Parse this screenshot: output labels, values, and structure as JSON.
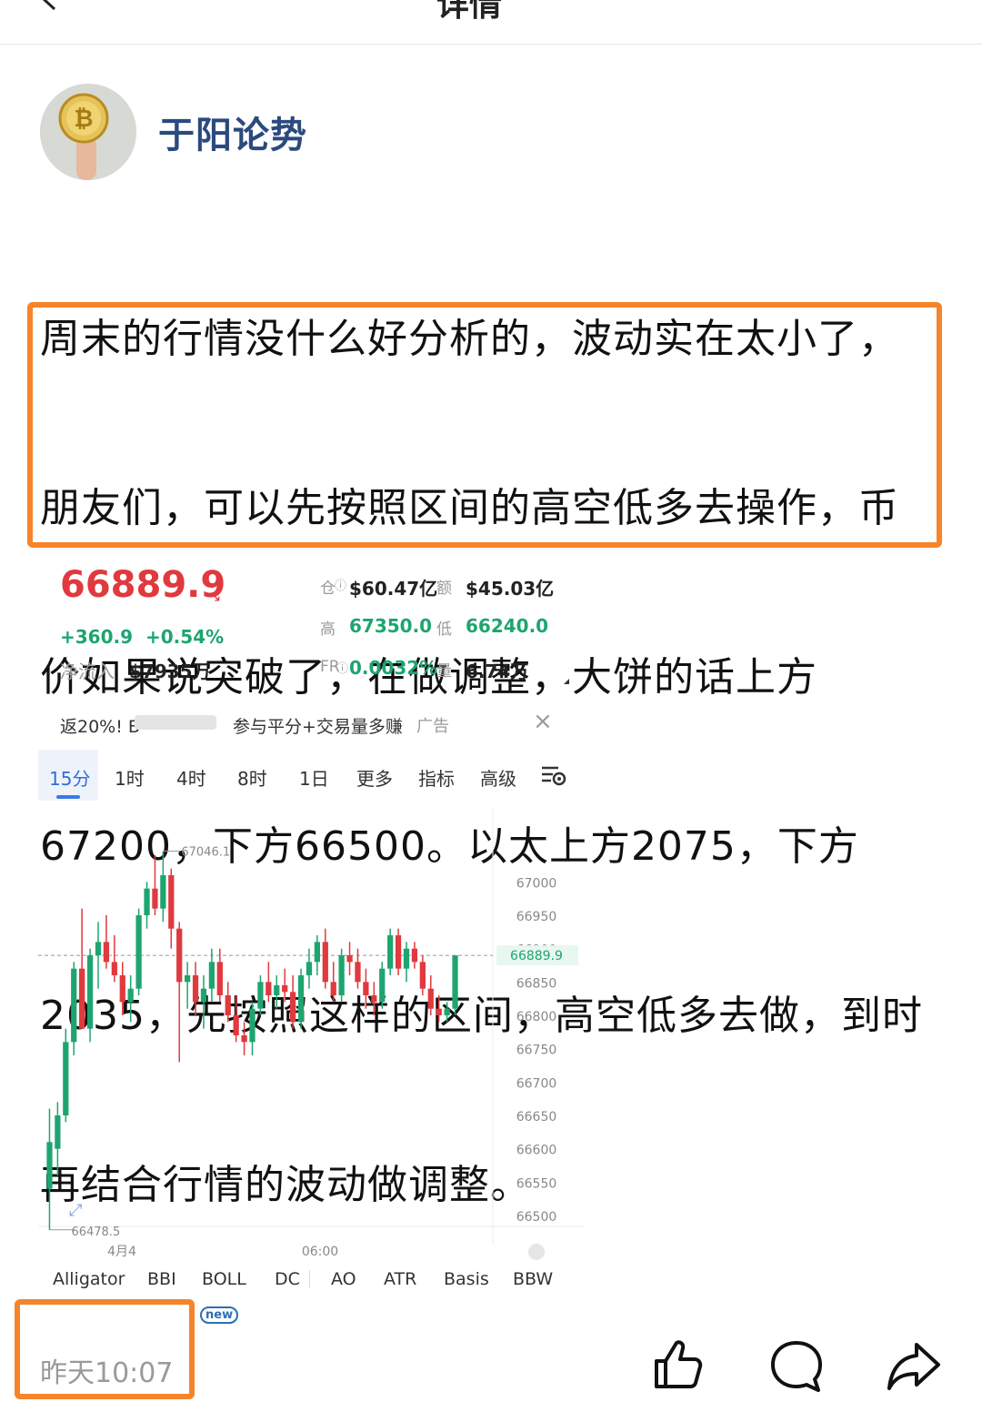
{
  "topbar": {
    "title": "详情"
  },
  "author": {
    "name": "于阳论势"
  },
  "post": {
    "lines": [
      "周末的行情没什么好分析的，波动实在太小了，",
      "朋友们，可以先按照区间的高空低多去操作，币",
      "价如果说突破了，在做调整，大饼的话上方",
      "67200，下方66500。以太上方2075，下方",
      "2035，先按照这样的区间，高空低多去做，到时",
      "再结合行情的波动做调整。"
    ]
  },
  "ticker": {
    "price": "66889.9",
    "change": "+360.9",
    "change_pct": "+0.54%",
    "netflow_label": "净流入",
    "netflow": "$7935万",
    "oi_label": "仓",
    "oi": "$60.47亿",
    "turnover_label": "额",
    "turnover": "$45.03亿",
    "high_label": "高",
    "high": "67350.0",
    "low_label": "低",
    "low": "66240.0",
    "fr_label": "FR",
    "fr": "0.0032%",
    "volume_label": "量",
    "volume": "6.74万"
  },
  "ad": {
    "prefix": "返20%! B",
    "text": "参与平分+交易量多赚",
    "tag": "广告",
    "close": "×"
  },
  "tabs": [
    "15分",
    "1时",
    "4时",
    "8时",
    "1日",
    "更多",
    "指标",
    "高级"
  ],
  "active_tab": 0,
  "indicators": [
    "Alligator",
    "BBI",
    "BOLL",
    "DC",
    "AO",
    "ATR",
    "Basis",
    "BBW"
  ],
  "new_badge": "new",
  "post_time": "昨天10:07",
  "colors": {
    "up": "#1ea56f",
    "down": "#e0393e",
    "accent": "#f5842a",
    "author": "#2b4a7e"
  },
  "chart_data": {
    "type": "candlestick",
    "y_ticks": [
      67000,
      66950,
      66900,
      66850,
      66800,
      66750,
      66700,
      66650,
      66600,
      66550,
      66500
    ],
    "ylim": [
      66470,
      67070
    ],
    "x_labels": [
      "4月4",
      "06:00"
    ],
    "current_price": "66889.9",
    "high_annotation": "67046.1",
    "low_annotation": "66478.5",
    "candles": [
      {
        "o": 66540,
        "h": 66660,
        "l": 66478.5,
        "c": 66610
      },
      {
        "o": 66600,
        "h": 66670,
        "l": 66560,
        "c": 66650
      },
      {
        "o": 66650,
        "h": 66780,
        "l": 66640,
        "c": 66760
      },
      {
        "o": 66760,
        "h": 66880,
        "l": 66740,
        "c": 66870
      },
      {
        "o": 66870,
        "h": 66960,
        "l": 66820,
        "c": 66780
      },
      {
        "o": 66780,
        "h": 66900,
        "l": 66760,
        "c": 66890
      },
      {
        "o": 66890,
        "h": 66940,
        "l": 66840,
        "c": 66910
      },
      {
        "o": 66910,
        "h": 66950,
        "l": 66870,
        "c": 66880
      },
      {
        "o": 66880,
        "h": 66920,
        "l": 66850,
        "c": 66860
      },
      {
        "o": 66860,
        "h": 66880,
        "l": 66800,
        "c": 66820
      },
      {
        "o": 66820,
        "h": 66860,
        "l": 66790,
        "c": 66840
      },
      {
        "o": 66840,
        "h": 66960,
        "l": 66830,
        "c": 66950
      },
      {
        "o": 66950,
        "h": 67000,
        "l": 66930,
        "c": 66990
      },
      {
        "o": 66990,
        "h": 67040,
        "l": 66950,
        "c": 66960
      },
      {
        "o": 66960,
        "h": 67046.1,
        "l": 66940,
        "c": 67010
      },
      {
        "o": 67010,
        "h": 67020,
        "l": 66900,
        "c": 66930
      },
      {
        "o": 66930,
        "h": 66940,
        "l": 66730,
        "c": 66850
      },
      {
        "o": 66850,
        "h": 66880,
        "l": 66810,
        "c": 66860
      },
      {
        "o": 66860,
        "h": 66880,
        "l": 66800,
        "c": 66820
      },
      {
        "o": 66820,
        "h": 66860,
        "l": 66780,
        "c": 66840
      },
      {
        "o": 66840,
        "h": 66900,
        "l": 66820,
        "c": 66880
      },
      {
        "o": 66880,
        "h": 66900,
        "l": 66820,
        "c": 66830
      },
      {
        "o": 66830,
        "h": 66850,
        "l": 66790,
        "c": 66800
      },
      {
        "o": 66800,
        "h": 66830,
        "l": 66760,
        "c": 66770
      },
      {
        "o": 66770,
        "h": 66790,
        "l": 66740,
        "c": 66760
      },
      {
        "o": 66760,
        "h": 66820,
        "l": 66740,
        "c": 66810
      },
      {
        "o": 66810,
        "h": 66860,
        "l": 66800,
        "c": 66850
      },
      {
        "o": 66850,
        "h": 66880,
        "l": 66820,
        "c": 66830
      },
      {
        "o": 66830,
        "h": 66860,
        "l": 66810,
        "c": 66845
      },
      {
        "o": 66845,
        "h": 66870,
        "l": 66820,
        "c": 66835
      },
      {
        "o": 66835,
        "h": 66860,
        "l": 66780,
        "c": 66790
      },
      {
        "o": 66790,
        "h": 66870,
        "l": 66780,
        "c": 66860
      },
      {
        "o": 66860,
        "h": 66900,
        "l": 66840,
        "c": 66880
      },
      {
        "o": 66880,
        "h": 66920,
        "l": 66860,
        "c": 66910
      },
      {
        "o": 66910,
        "h": 66930,
        "l": 66840,
        "c": 66850
      },
      {
        "o": 66850,
        "h": 66880,
        "l": 66820,
        "c": 66830
      },
      {
        "o": 66830,
        "h": 66900,
        "l": 66820,
        "c": 66890
      },
      {
        "o": 66890,
        "h": 66910,
        "l": 66860,
        "c": 66880
      },
      {
        "o": 66880,
        "h": 66900,
        "l": 66840,
        "c": 66850
      },
      {
        "o": 66850,
        "h": 66870,
        "l": 66810,
        "c": 66830
      },
      {
        "o": 66830,
        "h": 66850,
        "l": 66800,
        "c": 66820
      },
      {
        "o": 66820,
        "h": 66880,
        "l": 66810,
        "c": 66870
      },
      {
        "o": 66870,
        "h": 66930,
        "l": 66860,
        "c": 66920
      },
      {
        "o": 66920,
        "h": 66930,
        "l": 66860,
        "c": 66870
      },
      {
        "o": 66870,
        "h": 66910,
        "l": 66850,
        "c": 66900
      },
      {
        "o": 66900,
        "h": 66910,
        "l": 66870,
        "c": 66880
      },
      {
        "o": 66880,
        "h": 66890,
        "l": 66830,
        "c": 66840
      },
      {
        "o": 66840,
        "h": 66860,
        "l": 66800,
        "c": 66810
      },
      {
        "o": 66810,
        "h": 66830,
        "l": 66790,
        "c": 66800
      },
      {
        "o": 66800,
        "h": 66820,
        "l": 66790,
        "c": 66810
      },
      {
        "o": 66810,
        "h": 66890,
        "l": 66800,
        "c": 66889.9
      }
    ]
  }
}
